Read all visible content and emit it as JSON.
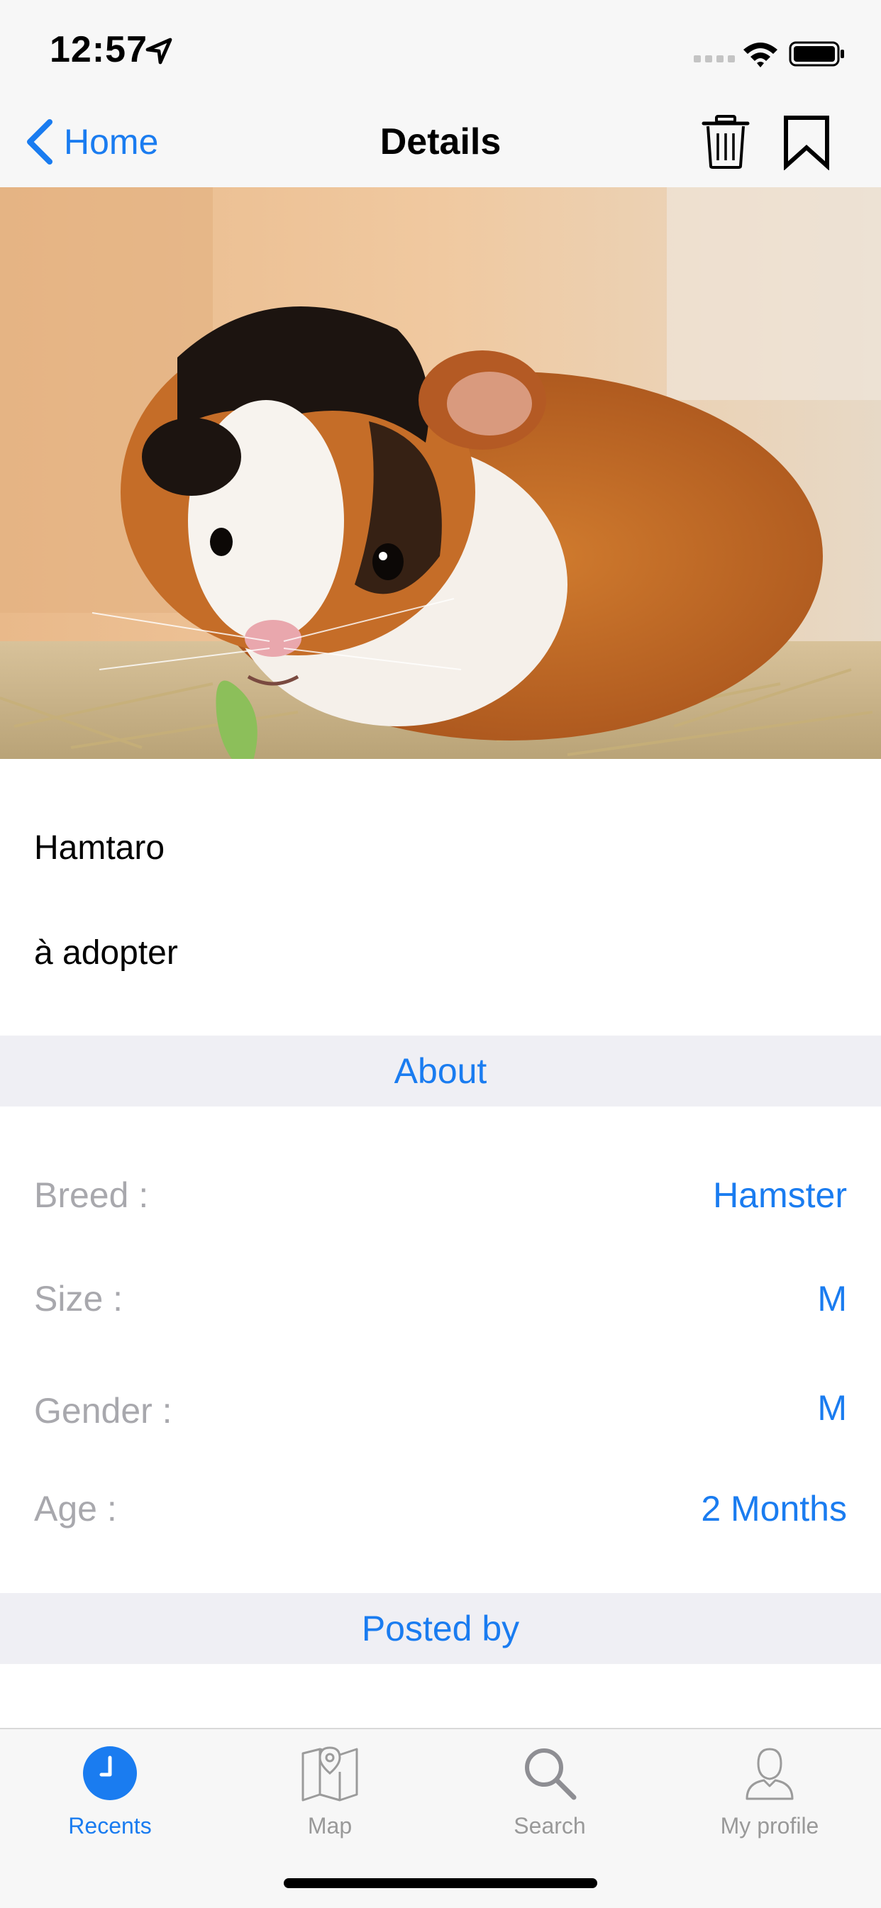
{
  "status_bar": {
    "time": "12:57"
  },
  "nav": {
    "back_label": "Home",
    "title": "Details"
  },
  "pet": {
    "name": "Hamtaro",
    "status": "à adopter"
  },
  "sections": {
    "about": "About",
    "posted_by": "Posted by"
  },
  "details": [
    {
      "label": "Breed :",
      "value": "Hamster"
    },
    {
      "label": "Size :",
      "value": "M"
    },
    {
      "label": "Gender :",
      "value": "M"
    },
    {
      "label": "Age :",
      "value": "2 Months"
    }
  ],
  "tabs": [
    {
      "label": "Recents",
      "icon": "clock-icon",
      "active": true
    },
    {
      "label": "Map",
      "icon": "map-icon",
      "active": false
    },
    {
      "label": "Search",
      "icon": "search-icon",
      "active": false
    },
    {
      "label": "My profile",
      "icon": "person-icon",
      "active": false
    }
  ],
  "colors": {
    "accent": "#1a7cf0",
    "label_gray": "#a8a8ad",
    "section_bg": "#efeff4"
  }
}
